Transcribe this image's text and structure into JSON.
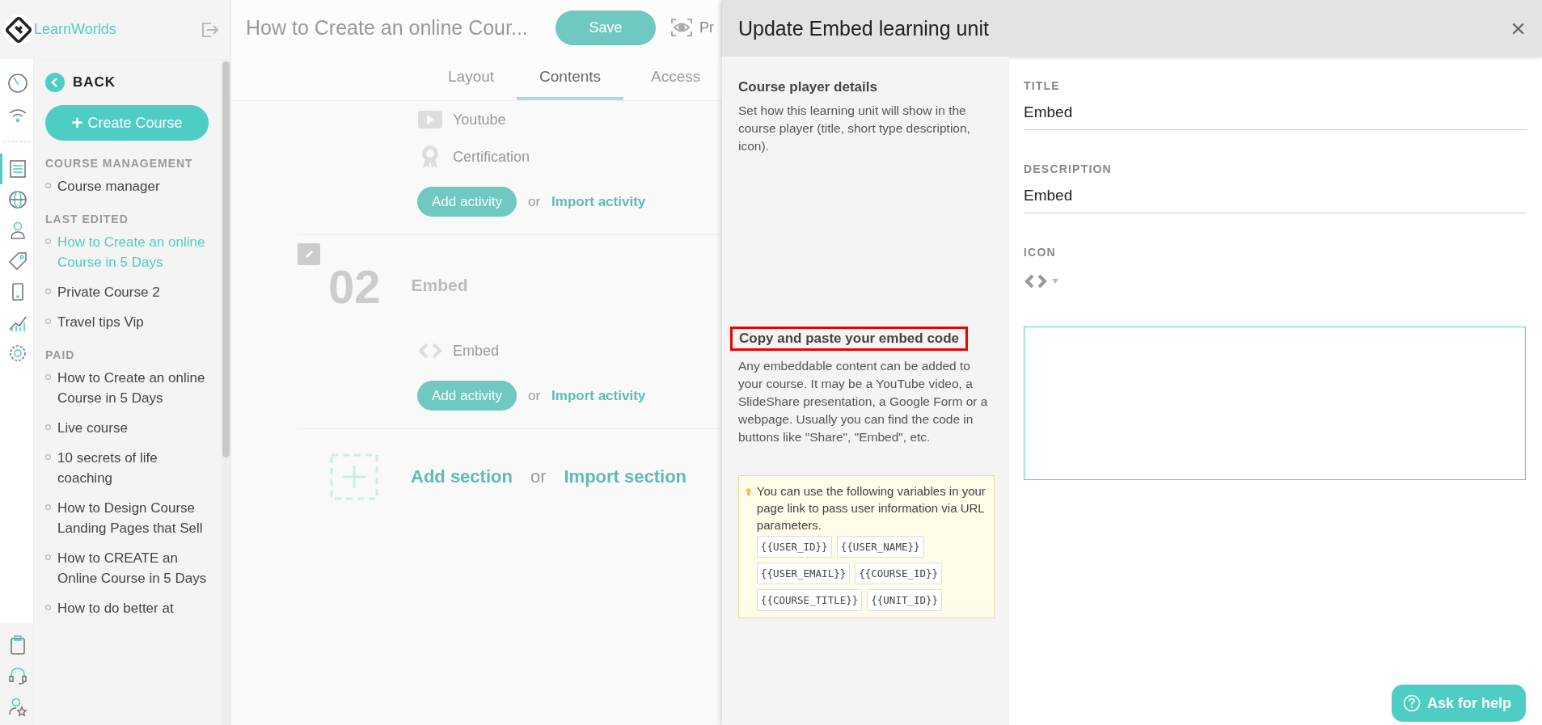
{
  "app": {
    "name": "LearnWorlds"
  },
  "rail": {
    "top": [
      {
        "kind": "gauge",
        "selected": false
      },
      {
        "kind": "wifi",
        "selected": false
      }
    ],
    "middle": [
      {
        "kind": "list",
        "selected": true
      },
      {
        "kind": "globe",
        "selected": false
      },
      {
        "kind": "user",
        "selected": false
      },
      {
        "kind": "tag",
        "selected": false
      },
      {
        "kind": "phone",
        "selected": false
      },
      {
        "kind": "chart",
        "selected": false
      },
      {
        "kind": "gear",
        "selected": false
      }
    ],
    "bottom": [
      {
        "kind": "clipboard",
        "selected": false
      },
      {
        "kind": "headset",
        "selected": false
      },
      {
        "kind": "star-user",
        "selected": false
      }
    ]
  },
  "sidebar": {
    "back": "BACK",
    "create": {
      "icon": "+",
      "label": "Create Course"
    },
    "sections": [
      {
        "heading": "COURSE MANAGEMENT",
        "items": [
          {
            "label": "Course manager",
            "selected": false
          }
        ]
      },
      {
        "heading": "LAST EDITED",
        "items": [
          {
            "label": "How to Create an online Course in 5 Days",
            "selected": true
          },
          {
            "label": "Private Course 2",
            "selected": false
          },
          {
            "label": "Travel tips Vip",
            "selected": false
          }
        ]
      },
      {
        "heading": "PAID",
        "items": [
          {
            "label": "How to Create an online Course in 5 Days",
            "selected": false
          },
          {
            "label": "Live course",
            "selected": false
          },
          {
            "label": "10 secrets of life coaching",
            "selected": false
          },
          {
            "label": "How to Design Course Landing Pages that Sell",
            "selected": false
          },
          {
            "label": "How to CREATE an Online Course in 5 Days",
            "selected": false
          },
          {
            "label": "How to do better at",
            "selected": false
          }
        ]
      }
    ]
  },
  "editor": {
    "title": "How to Create an online Cour...",
    "save": "Save",
    "preview": "Pr",
    "tabs": [
      {
        "label": "Layout",
        "selected": false
      },
      {
        "label": "Contents",
        "selected": true
      },
      {
        "label": "Access",
        "selected": false
      }
    ],
    "sections": [
      {
        "activities": [
          {
            "kind": "video",
            "label": "Youtube"
          },
          {
            "kind": "certificate",
            "label": "Certification"
          }
        ],
        "add": "Add activity",
        "or": "or",
        "import": "Import activity"
      },
      {
        "number": "02",
        "title": "Embed",
        "activities": [
          {
            "kind": "embed",
            "label": "Embed"
          }
        ],
        "add": "Add activity",
        "or": "or",
        "import": "Import activity"
      }
    ],
    "add_section": "Add section",
    "or": "or",
    "import_section": "Import section"
  },
  "modal": {
    "title": "Update Embed learning unit",
    "close": "×",
    "details": {
      "heading": "Course player details",
      "text": "Set how this learning unit will show in the course player (title, short type description, icon)."
    },
    "embed": {
      "heading": "Copy and paste your embed code",
      "highlighted": true,
      "text": "Any embeddable content can be added to your course. It may be a YouTube video, a SlideShare presentation, a Google Form or a webpage. Usually you can find the code in buttons like \"Share\", \"Embed\", etc."
    },
    "tip": {
      "text": "You can use the following variables in your page link to pass user information via URL parameters.",
      "variables": [
        "{{USER_ID}}",
        "{{USER_NAME}}",
        "{{USER_EMAIL}}",
        "{{COURSE_ID}}",
        "{{COURSE_TITLE}}",
        "{{UNIT_ID}}"
      ]
    },
    "fields": [
      {
        "label": "TITLE",
        "value": "Embed"
      },
      {
        "label": "DESCRIPTION",
        "value": "Embed"
      }
    ],
    "icon_label": "ICON"
  },
  "help": "Ask for help"
}
